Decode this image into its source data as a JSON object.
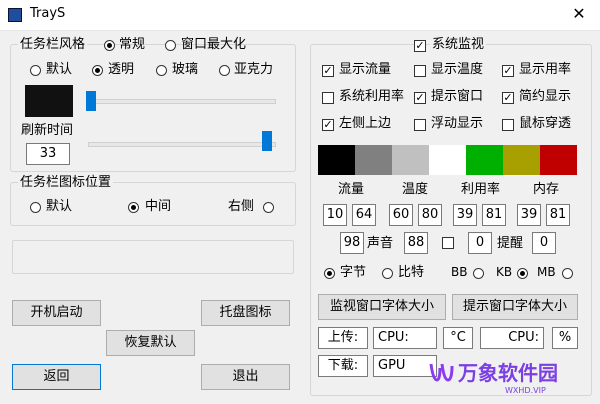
{
  "window": {
    "title": "TrayS",
    "close": "✕"
  },
  "taskbar": {
    "group_label": "任务栏风格",
    "mode_normal": "常规",
    "mode_maximize": "窗口最大化",
    "styles": [
      "默认",
      "透明",
      "玻璃",
      "亚克力"
    ],
    "refresh_label": "刷新时间",
    "refresh_value": "33",
    "color_swatch": "#111111"
  },
  "icon_position": {
    "group_label": "任务栏图标位置",
    "options": [
      "默认",
      "中间",
      "右侧"
    ]
  },
  "buttons": {
    "autostart": "开机启动",
    "tray_icon": "托盘图标",
    "restore_default": "恢复默认",
    "back": "返回",
    "exit": "退出"
  },
  "monitor": {
    "group_label": "系统监视",
    "options": [
      "显示流量",
      "显示温度",
      "显示用率",
      "系统利用率",
      "提示窗口",
      "简约显示",
      "左侧上边",
      "浮动显示",
      "鼠标穿透"
    ],
    "checked": [
      true,
      false,
      true,
      false,
      true,
      true,
      true,
      false,
      false
    ],
    "colors": [
      "#000000",
      "#808080",
      "#c0c0c0",
      "#ffffff",
      "#00b000",
      "#a8a000",
      "#c00000"
    ],
    "headers": [
      "流量",
      "温度",
      "利用率",
      "内存"
    ],
    "values": [
      "10",
      "64",
      "60",
      "80",
      "39",
      "81",
      "39",
      "81"
    ],
    "sound_value_left": "98",
    "sound_label": "声音",
    "sound_value": "88",
    "remind_left": "0",
    "remind_label": "提醒",
    "remind_value": "0",
    "units": [
      "字节",
      "比特",
      "BB",
      "KB",
      "MB"
    ],
    "font_monitor_btn": "监视窗口字体大小",
    "font_tip_btn": "提示窗口字体大小",
    "upload_label": "上传:",
    "download_label": "下载:",
    "cpu_label": "CPU:",
    "celsius": "°C",
    "cpu_label2": "CPU:",
    "percent": "%",
    "gpu_label": "GPU"
  },
  "watermark": {
    "text": "万象软件园",
    "sub": "WXHD.VIP"
  }
}
